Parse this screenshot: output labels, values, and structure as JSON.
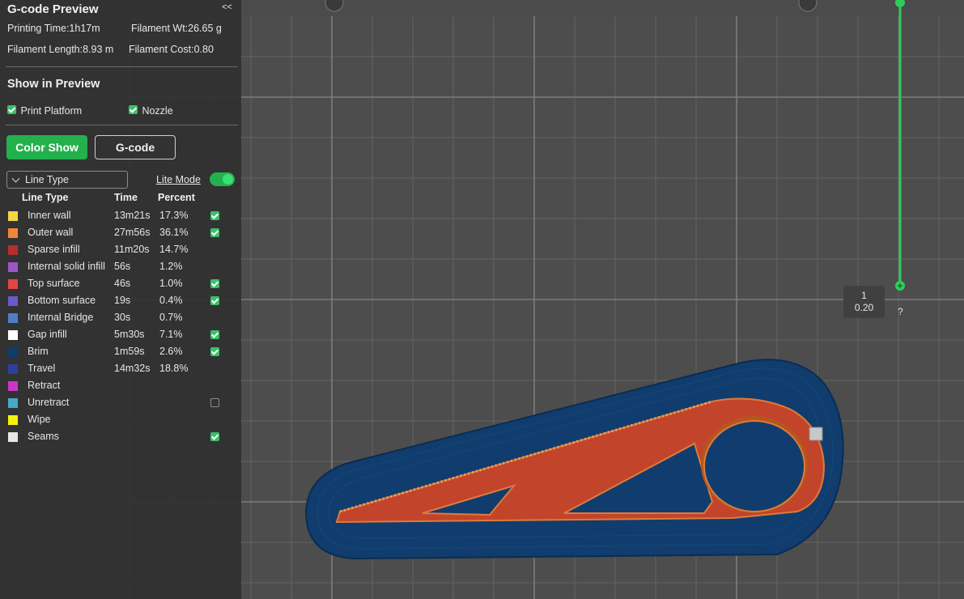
{
  "panel": {
    "title": "G-code Preview",
    "collapse_label": "<<",
    "stats": {
      "printing_time": "Printing Time:1h17m",
      "filament_wt": "Filament Wt:26.65 g",
      "filament_length": "Filament Length:8.93 m",
      "filament_cost": "Filament Cost:0.80"
    },
    "show_in_preview": {
      "title": "Show in Preview",
      "print_platform": {
        "label": "Print Platform",
        "checked": true
      },
      "nozzle": {
        "label": "Nozzle",
        "checked": true
      }
    },
    "buttons": {
      "color_show": "Color Show",
      "gcode": "G-code"
    },
    "view_select": {
      "value": "Line Type"
    },
    "lite_mode": {
      "label": "Lite Mode",
      "on": true
    },
    "table": {
      "headers": {
        "line_type": "Line Type",
        "time": "Time",
        "percent": "Percent"
      },
      "rows": [
        {
          "name": "Inner wall",
          "time": "13m21s",
          "percent": "17.3%",
          "color": "#f5d547",
          "checkbox": "checked"
        },
        {
          "name": "Outer wall",
          "time": "27m56s",
          "percent": "36.1%",
          "color": "#f0863a",
          "checkbox": "checked"
        },
        {
          "name": "Sparse infill",
          "time": "11m20s",
          "percent": "14.7%",
          "color": "#b52f2f",
          "checkbox": "none"
        },
        {
          "name": "Internal solid infill",
          "time": "56s",
          "percent": "1.2%",
          "color": "#9b56c9",
          "checkbox": "none"
        },
        {
          "name": "Top surface",
          "time": "46s",
          "percent": "1.0%",
          "color": "#e84444",
          "checkbox": "checked"
        },
        {
          "name": "Bottom surface",
          "time": "19s",
          "percent": "0.4%",
          "color": "#6a5ac9",
          "checkbox": "checked"
        },
        {
          "name": "Internal Bridge",
          "time": "30s",
          "percent": "0.7%",
          "color": "#4d7fc2",
          "checkbox": "none"
        },
        {
          "name": "Gap infill",
          "time": "5m30s",
          "percent": "7.1%",
          "color": "#ffffff",
          "checkbox": "checked"
        },
        {
          "name": "Brim",
          "time": "1m59s",
          "percent": "2.6%",
          "color": "#0e3f6b",
          "checkbox": "checked"
        },
        {
          "name": "Travel",
          "time": "14m32s",
          "percent": "18.8%",
          "color": "#2e3f9e",
          "checkbox": "none"
        },
        {
          "name": "Retract",
          "time": "",
          "percent": "",
          "color": "#c837c8",
          "checkbox": "none"
        },
        {
          "name": "Unretract",
          "time": "",
          "percent": "",
          "color": "#48a8c8",
          "checkbox": "unchecked"
        },
        {
          "name": "Wipe",
          "time": "",
          "percent": "",
          "color": "#f2f20d",
          "checkbox": "none"
        },
        {
          "name": "Seams",
          "time": "",
          "percent": "",
          "color": "#e6e6e6",
          "checkbox": "checked"
        }
      ]
    }
  },
  "layer_slider": {
    "layer": "1",
    "height": "0.20",
    "help": "?"
  },
  "colors": {
    "accent": "#22b14c",
    "slider": "#2ecc5a"
  }
}
